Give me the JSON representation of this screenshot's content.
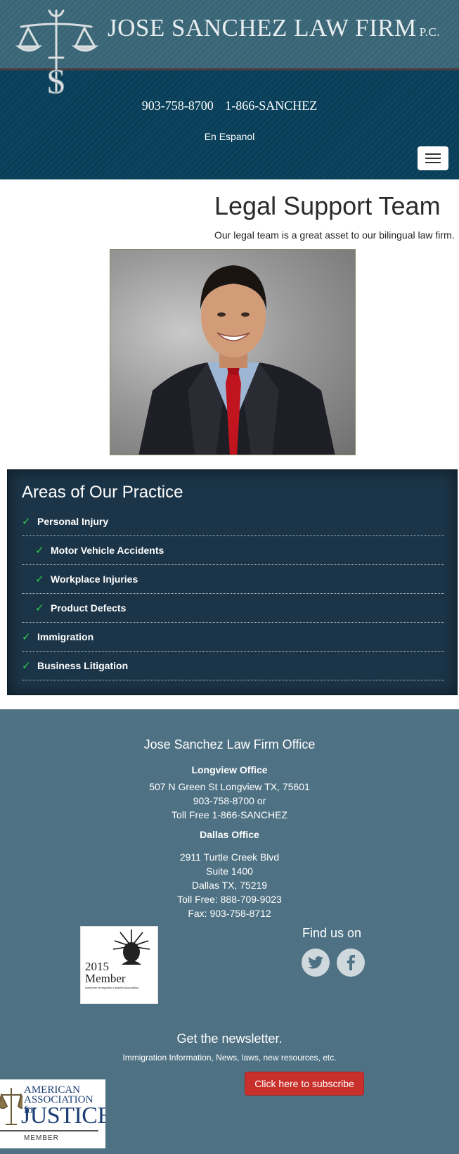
{
  "header": {
    "firm_name": "JOSE SANCHEZ LAW FIRM",
    "firm_suffix": "P.C.",
    "phone_local": "903-758-8700",
    "phone_toll_free": "1-866-SANCHEZ",
    "language_link": "En Espanol",
    "menu_icon": "hamburger-icon"
  },
  "main": {
    "title": "Legal Support Team",
    "subtitle": "Our legal team is a great asset to our bilingual law firm."
  },
  "practice": {
    "title": "Areas of Our Practice",
    "items": [
      {
        "label": "Personal Injury"
      },
      {
        "label": "Motor Vehicle Accidents"
      },
      {
        "label": "Workplace Injuries"
      },
      {
        "label": "Product Defects"
      },
      {
        "label": "Immigration"
      },
      {
        "label": "Business Litigation"
      }
    ],
    "check_icon": "check-icon"
  },
  "footer": {
    "office_title": "Jose Sanchez Law Firm Office",
    "longview": {
      "title": "Longview Office",
      "line1": "507 N Green St Longview TX, 75601",
      "line2": "903-758-8700 or",
      "line3": "Toll Free 1-866-SANCHEZ"
    },
    "dallas": {
      "title": "Dallas Office",
      "line1": "2911 Turtle Creek Blvd",
      "line2": "Suite 1400",
      "line3": "Dallas TX, 75219",
      "line4": "Toll Free: 888-709-9023",
      "line5": "Fax: 903-758-8712"
    },
    "badge": {
      "year": "2015",
      "word": "Member",
      "sub": "American Immigration Lawyers Association"
    },
    "find_us": "Find us on",
    "social": [
      "twitter-icon",
      "facebook-icon"
    ],
    "newsletter_title": "Get the newsletter.",
    "newsletter_sub": "Immigration Information, News, laws, new resources, etc.",
    "subscribe_label": "Click here to subscribe",
    "aaj": {
      "line1": "AMERICAN",
      "line2": "ASSOCIATION for",
      "line3": "JUSTICE",
      "line4": "MEMBER"
    }
  },
  "colors": {
    "header_dark": "#0b3e57",
    "practice_bg": "#1b3447",
    "footer_bg": "#4e7183",
    "check": "#2ad04a",
    "subscribe": "#c9302c"
  }
}
